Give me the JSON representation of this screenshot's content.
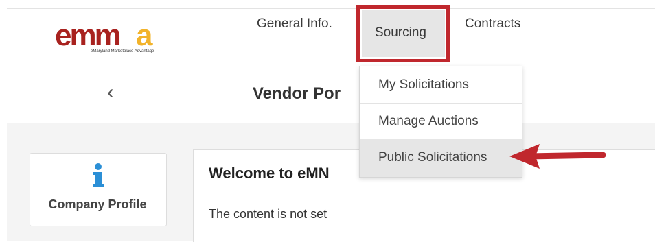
{
  "header": {
    "logo_text": "emma",
    "logo_tagline": "eMaryland Marketplace Advantage",
    "nav": [
      {
        "label": "General Info."
      },
      {
        "label": "Sourcing"
      },
      {
        "label": "Contracts"
      }
    ]
  },
  "subheader": {
    "back_glyph": "‹",
    "title": "Vendor Por"
  },
  "dropdown": {
    "items": [
      {
        "label": "My Solicitations"
      },
      {
        "label": "Manage Auctions"
      },
      {
        "label": "Public Solicitations"
      }
    ]
  },
  "sidebar": {
    "profile_label": "Company Profile",
    "profile_icon": "info-icon"
  },
  "welcome": {
    "title": "Welcome to eMN",
    "body": "The content is not set"
  },
  "colors": {
    "highlight": "#c0272d",
    "logo_red": "#a8221f",
    "logo_gold": "#f2b32a",
    "info_blue": "#2b8fd6"
  }
}
